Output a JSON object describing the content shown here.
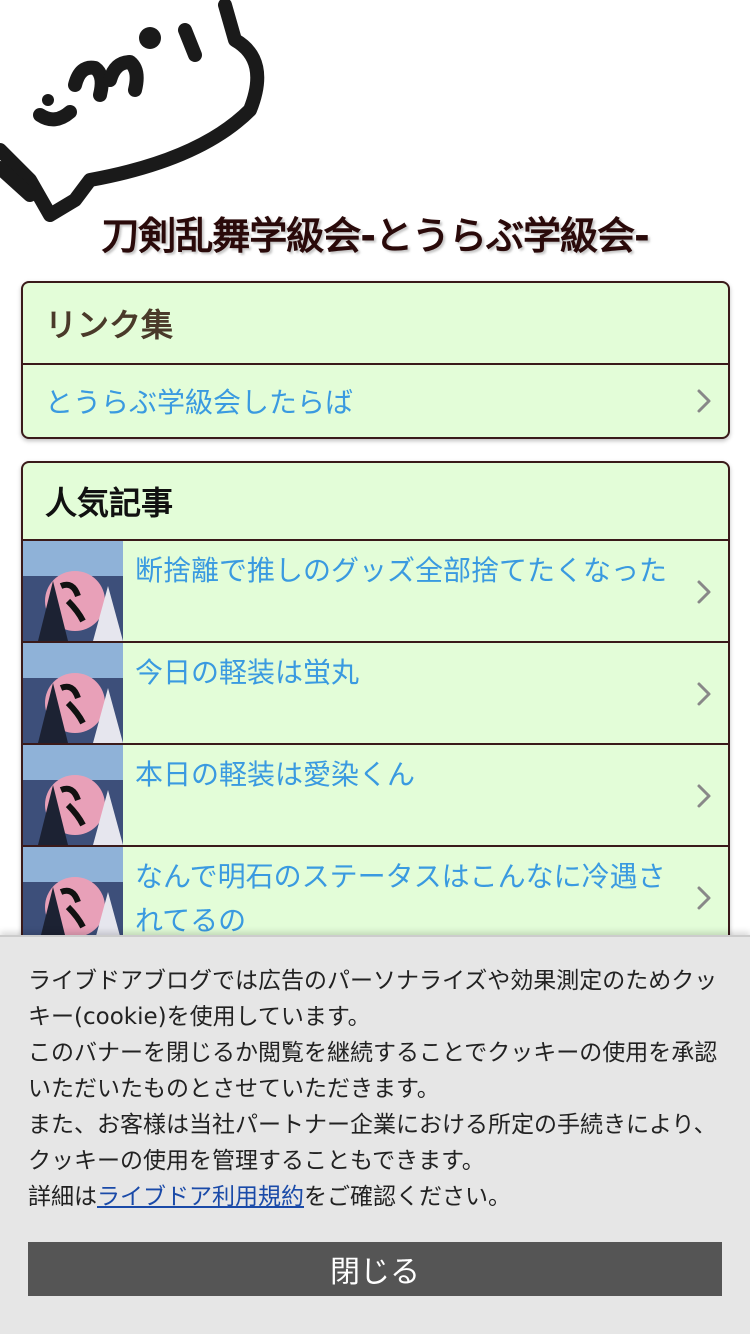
{
  "site": {
    "title": "刀剣乱舞学級会-とうらぶ学級会-"
  },
  "links_box": {
    "heading": "リンク集",
    "items": [
      {
        "label": "とうらぶ学級会したらば"
      }
    ]
  },
  "popular_box": {
    "heading": "人気記事",
    "items": [
      {
        "title": "断捨離で推しのグッズ全部捨てたくなった"
      },
      {
        "title": "今日の軽装は蛍丸"
      },
      {
        "title": "本日の軽装は愛染くん"
      },
      {
        "title": "なんで明石のステータスはこんなに冷遇されてるの"
      }
    ]
  },
  "cookie_banner": {
    "line1": "ライブドアブログでは広告のパーソナライズや効果測定のためクッキー(cookie)を使用しています。",
    "line2": "このバナーを閉じるか閲覧を継続することでクッキーの使用を承認いただいたものとさせていただきます。",
    "line3": "また、お客様は当社パートナー企業における所定の手続きにより、クッキーの使用を管理することもできます。",
    "detail_prefix": "詳細は",
    "detail_link": "ライブドア利用規約",
    "detail_suffix": "をご確認ください。",
    "close_label": "閉じる"
  },
  "colors": {
    "box_background": "#e3fdd8",
    "link_text": "#3a9ae0",
    "title_text": "#2a0a0a",
    "close_button": "#555555",
    "banner_background": "#e6e6e6"
  },
  "icons": [
    "chevron-right-icon",
    "speech-bubble-doodle"
  ]
}
